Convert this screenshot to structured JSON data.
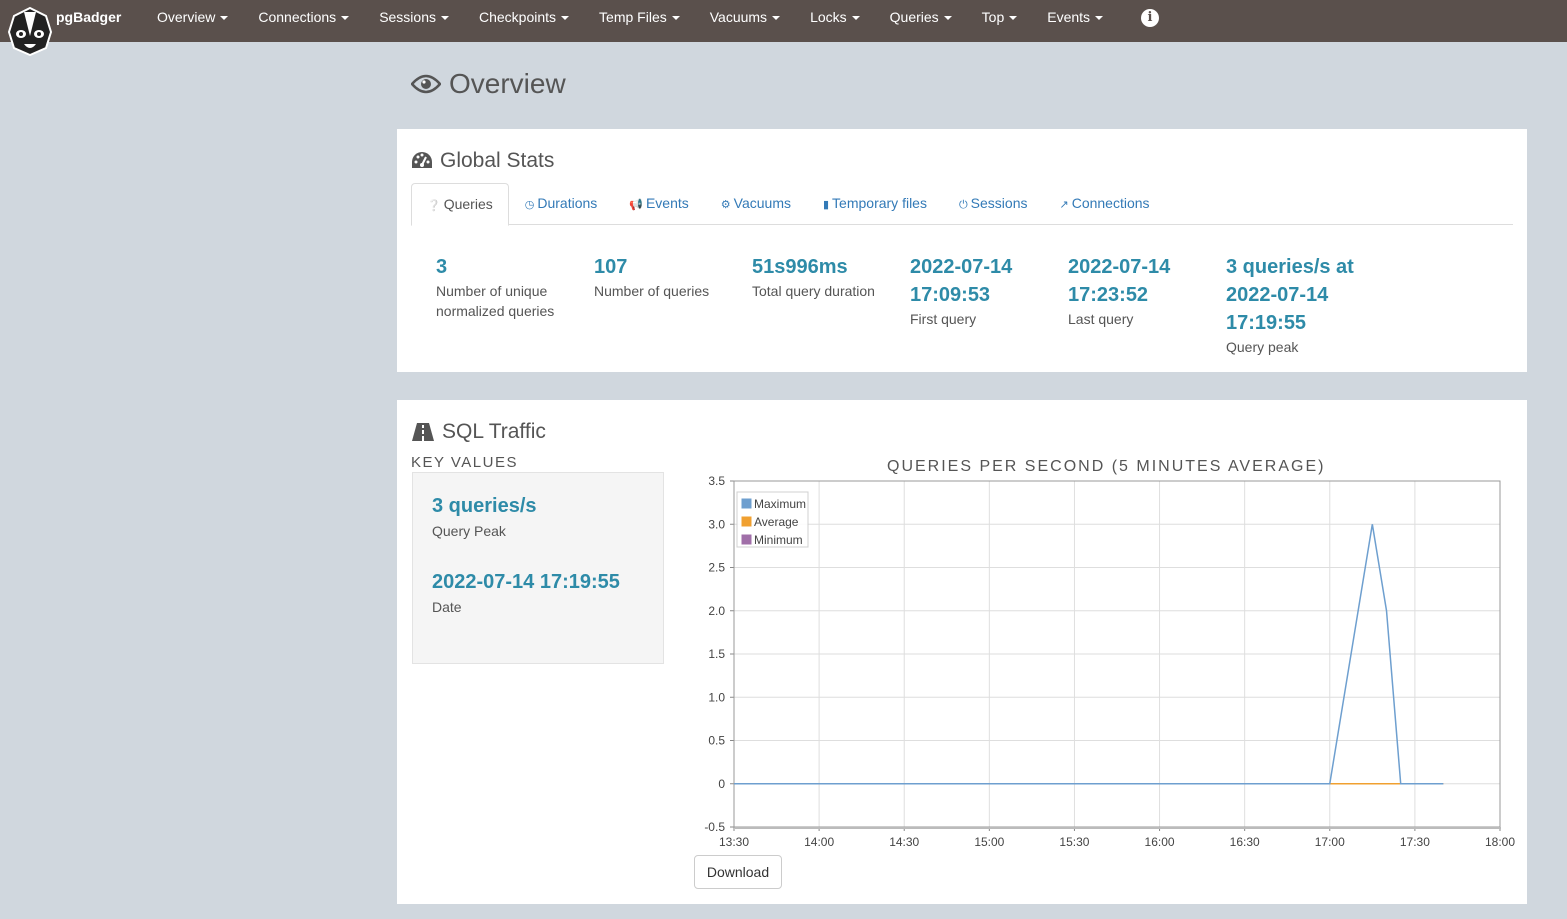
{
  "navbar": {
    "brand": "pgBadger",
    "items": [
      {
        "label": "Overview"
      },
      {
        "label": "Connections"
      },
      {
        "label": "Sessions"
      },
      {
        "label": "Checkpoints"
      },
      {
        "label": "Temp Files"
      },
      {
        "label": "Vacuums"
      },
      {
        "label": "Locks"
      },
      {
        "label": "Queries"
      },
      {
        "label": "Top"
      },
      {
        "label": "Events"
      }
    ],
    "info_icon": "info-icon"
  },
  "page": {
    "title": "Overview"
  },
  "global_stats": {
    "title": "Global Stats",
    "tabs": [
      {
        "label": "Queries",
        "icon": "question-icon"
      },
      {
        "label": "Durations",
        "icon": "clock-icon"
      },
      {
        "label": "Events",
        "icon": "bullhorn-icon"
      },
      {
        "label": "Vacuums",
        "icon": "cogs-icon"
      },
      {
        "label": "Temporary files",
        "icon": "file-icon"
      },
      {
        "label": "Sessions",
        "icon": "power-icon"
      },
      {
        "label": "Connections",
        "icon": "external-link-icon"
      }
    ],
    "stats": [
      {
        "value": "3",
        "label": "Number of unique normalized queries"
      },
      {
        "value": "107",
        "label": "Number of queries"
      },
      {
        "value": "51s996ms",
        "label": "Total query duration"
      },
      {
        "value": "2022-07-14 17:09:53",
        "label": "First query"
      },
      {
        "value": "2022-07-14 17:23:52",
        "label": "Last query"
      },
      {
        "value": "3 queries/s at 2022-07-14 17:19:55",
        "label": "Query peak"
      }
    ]
  },
  "sql_traffic": {
    "title": "SQL Traffic",
    "key_values_heading": "KEY VALUES",
    "key_values": [
      {
        "value": "3 queries/s",
        "label": "Query Peak"
      },
      {
        "value": "2022-07-14 17:19:55",
        "label": "Date"
      }
    ],
    "download_label": "Download"
  },
  "chart_data": {
    "type": "line",
    "title": "QUERIES PER SECOND (5 MINUTES AVERAGE)",
    "x_ticks": [
      "13:30",
      "14:00",
      "14:30",
      "15:00",
      "15:30",
      "16:00",
      "16:30",
      "17:00",
      "17:30",
      "18:00"
    ],
    "y_ticks": [
      "-0.5",
      "0",
      "0.5",
      "1.0",
      "1.5",
      "2.0",
      "2.5",
      "3.0",
      "3.5"
    ],
    "ylim": [
      -0.5,
      3.5
    ],
    "xlim": [
      "13:30",
      "18:00"
    ],
    "legend_position": "top-left",
    "grid": true,
    "series": [
      {
        "name": "Maximum",
        "color": "#6e9fcf",
        "points": [
          [
            "13:30",
            0
          ],
          [
            "17:00",
            0
          ],
          [
            "17:15",
            3
          ],
          [
            "17:20",
            2
          ],
          [
            "17:25",
            0
          ],
          [
            "17:40",
            0
          ]
        ]
      },
      {
        "name": "Average",
        "color": "#f0a030",
        "points": [
          [
            "13:30",
            0
          ],
          [
            "17:40",
            0
          ]
        ]
      },
      {
        "name": "Minimum",
        "color": "#a06fa8",
        "points": [
          [
            "13:30",
            0
          ],
          [
            "17:40",
            0
          ]
        ]
      }
    ]
  }
}
